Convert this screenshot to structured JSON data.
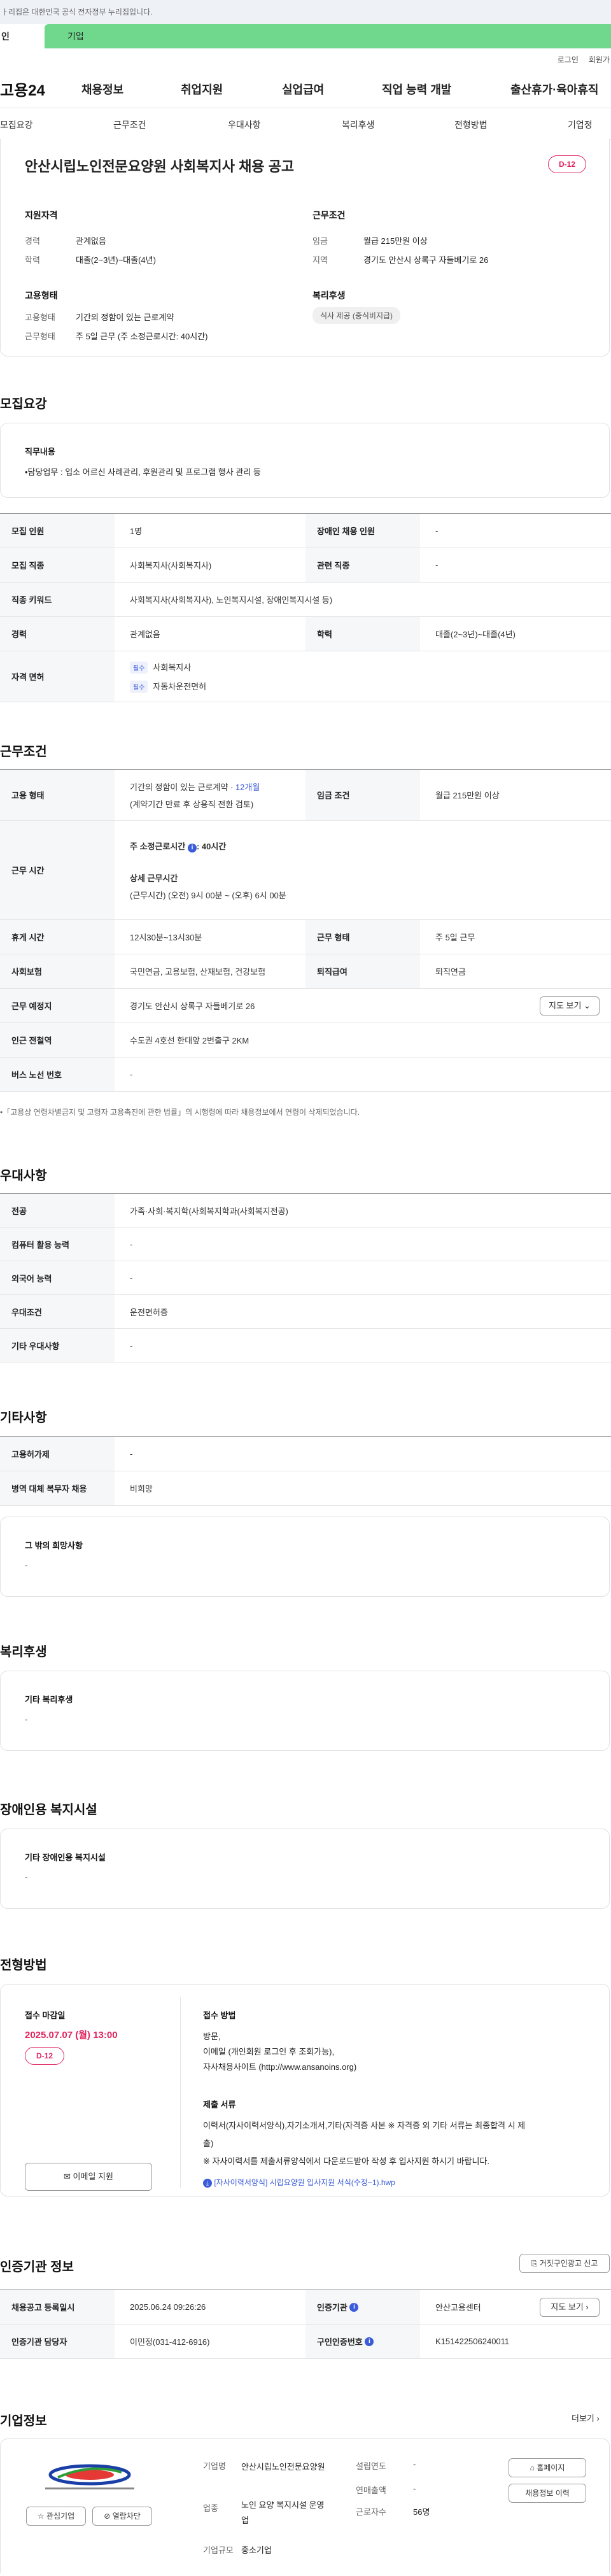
{
  "gov_banner": "ㅏ리집은 대한민국 공식 전자정부 누리집입니다.",
  "svc_tabs": [
    "인",
    "기업"
  ],
  "util": [
    "로그인",
    "회원가"
  ],
  "gnb": {
    "logo": "고용24",
    "menus": [
      "채용정보",
      "취업지원",
      "실업급여",
      "직업 능력 개발",
      "출산휴가·육아휴직"
    ]
  },
  "tabs": [
    "모집요강",
    "근무조건",
    "우대사항",
    "복리후생",
    "전형방법",
    "기업정"
  ],
  "summary": {
    "title": "안산시립노인전문요양원 사회복지사 채용 공고",
    "dday": "D-12",
    "qual": {
      "h": "지원자격",
      "rows": [
        [
          "경력",
          "관계없음"
        ],
        [
          "학력",
          "대졸(2~3년)~대졸(4년)"
        ]
      ]
    },
    "cond": {
      "h": "근무조건",
      "rows": [
        [
          "임금",
          "월급 215만원 이상"
        ],
        [
          "지역",
          "경기도 안산시 상록구 자들베기로 26"
        ]
      ]
    },
    "emp": {
      "h": "고용형태",
      "rows": [
        [
          "고용형태",
          "기간의 정함이 있는 근로계약"
        ],
        [
          "근무형태",
          "주 5일 근무 (주 소정근로시간: 40시간)"
        ]
      ]
    },
    "welfare": {
      "h": "복리후생",
      "chip": "식사 제공 (중식비지급)"
    }
  },
  "recruit": {
    "h": "모집요강",
    "duty_h": "직무내용",
    "duty": "•담당업무 : 입소 어르신 사례관리, 후원관리 및 프로그램 행사 관리 등",
    "rows": [
      {
        "a": "모집 인원",
        "b": "1명",
        "c": "장애인 채용 인원",
        "d": "-"
      },
      {
        "a": "모집 직종",
        "b": "사회복지사(사회복지사)",
        "c": "관련 직종",
        "d": "-"
      },
      {
        "a": "직종 키워드",
        "b": "사회복지사(사회복지사), 노인복지시설, 장애인복지시설 등)"
      },
      {
        "a": "경력",
        "b": "관계없음",
        "c": "학력",
        "d": "대졸(2~3년)~대졸(4년)"
      }
    ],
    "license_h": "자격 면허",
    "licenses": [
      {
        "tag": "필수",
        "name": "사회복지사"
      },
      {
        "tag": "필수",
        "name": "자동차운전면허"
      }
    ]
  },
  "work": {
    "h": "근무조건",
    "emp_h": "고용 형태",
    "emp_1": "기간의 정함이 있는 근로계약 · ",
    "emp_months": "12개월",
    "emp_2": "(계약기간 만료 후 상용직 전환 검토)",
    "wage_h": "임금 조건",
    "wage": "월급 215만원 이상",
    "time_h": "근무 시간",
    "time_1": "주 소정근로시간",
    "time_1v": ": 40시간",
    "time_2": "상세 근무시간",
    "time_3": "(근무시간) (오전) 9시 00분 ~ (오후) 6시 00분",
    "rest_h": "휴게 시간",
    "rest": "12시30분~13시30분",
    "form_h": "근무 형태",
    "form": "주 5일 근무",
    "ins_h": "사회보험",
    "ins": "국민연금, 고용보험, 산재보험, 건강보험",
    "ret_h": "퇴직급여",
    "ret": "퇴직연금",
    "place_h": "근무 예정지",
    "place": "경기도 안산시 상록구 자들베기로 26",
    "map_btn": "지도 보기",
    "sub_h": "인근 전철역",
    "sub": "수도권 4호선 한대앞 2번출구 2KM",
    "bus_h": "버스 노선 번호",
    "bus": "-",
    "note": "•「고용상 연령차별금지 및 고령자 고용촉진에 관한 법률」의 시행령에 따라 채용정보에서 연령이 삭제되었습니다."
  },
  "pref": {
    "h": "우대사항",
    "rows": [
      [
        "전공",
        "가족·사회·복지학(사회복지학과(사회복지전공)"
      ],
      [
        "컴퓨터 활용 능력",
        "-"
      ],
      [
        "외국어 능력",
        "-"
      ],
      [
        "우대조건",
        "운전면허증"
      ],
      [
        "기타 우대사항",
        "-"
      ]
    ]
  },
  "etc": {
    "h": "기타사항",
    "rows": [
      [
        "고용허가제",
        "-"
      ],
      [
        "병역 대체 복무자 채용",
        "비희망"
      ]
    ],
    "hope_h": "그 밖의 희망사항",
    "hope": "-"
  },
  "benefit": {
    "h": "복리후생",
    "sub_h": "기타 복리후생",
    "val": "-"
  },
  "disab": {
    "h": "장애인용 복지시설",
    "sub_h": "기타 장애인용 복지시설",
    "val": "-"
  },
  "process": {
    "h": "전형방법",
    "deadline_h": "접수 마감일",
    "deadline": "2025.07.07 (월) 13:00",
    "dday": "D-12",
    "email_btn": "이메일 지원",
    "method_h": "접수 방법",
    "method": [
      "방문,",
      "이메일 (개인회원 로그인 후 조회가능),",
      "자사채용사이트 (http://www.ansanoins.org)"
    ],
    "docs_h": "제출 서류",
    "docs": [
      "이력서(자사이력서양식),자기소개서,기타(자격증 사본 ※ 자격증 외 기타 서류는 최종합격 시 제",
      "출)",
      "※ 자사이력서를 제출서류양식에서 다운로드받아 작성 후 입사지원 하시기 바랍니다."
    ],
    "file": "[자사이력서양식] 시립요양원 입사지원 서식(수정~1).hwp"
  },
  "agency": {
    "h": "인증기관 정보",
    "report_btn": "거짓구인광고 신고",
    "rows": [
      {
        "a": "채용공고 등록일시",
        "b": "2025.06.24 09:26:26",
        "c": "인증기관",
        "d": "안산고용센터",
        "btn": "지도 보기"
      },
      {
        "a": "인증기관 담당자",
        "b": "이민정(031-412-6916)",
        "c": "구인인증번호",
        "d": "K151422506240011"
      }
    ]
  },
  "company": {
    "h": "기업정보",
    "more": "더보기",
    "fav": "관심기업",
    "block": "열람차단",
    "name_h": "기업명",
    "name": "안산시립노인전문요양원",
    "est_h": "설립연도",
    "est": "-",
    "biz_h": "업종",
    "biz": "노인 요양 복지시설 운영업",
    "sales_h": "연매출액",
    "sales": "-",
    "emp_h": "근로자수",
    "emp": "56명",
    "size_h": "기업규모",
    "size": "중소기업",
    "home_btn": "홈페이지",
    "jobs_btn": "채용정보 이력"
  },
  "colors": {
    "accent": "#e0245e",
    "green": "#6fd88c",
    "blue": "#3b5bdb"
  }
}
